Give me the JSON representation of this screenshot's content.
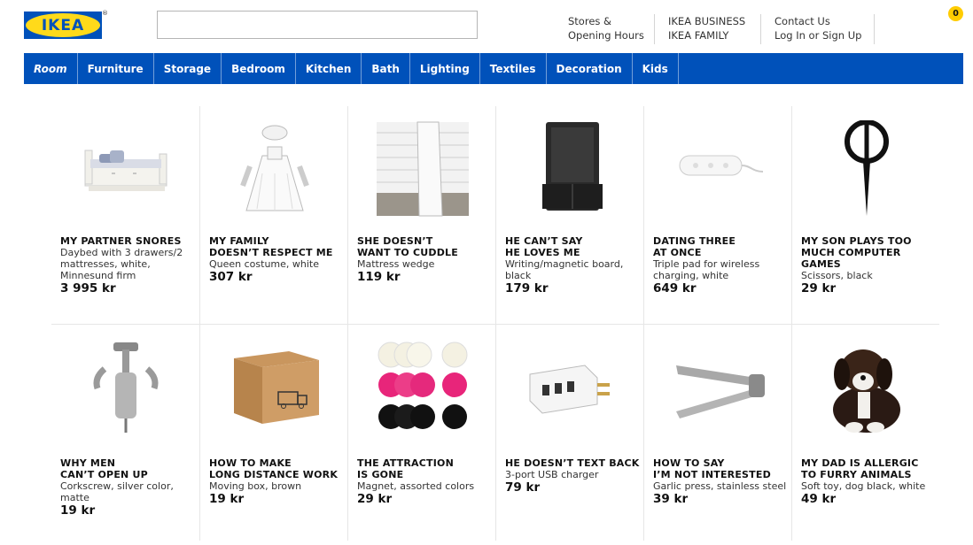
{
  "header": {
    "logo_text": "IKEA",
    "logo_reg": "®",
    "search": {
      "value": "",
      "placeholder": ""
    },
    "links": {
      "stores_line1": "Stores &",
      "stores_line2": "Opening Hours",
      "business": "IKEA BUSINESS",
      "family": "IKEA FAMILY",
      "contact": "Contact Us",
      "login": "Log In or Sign Up"
    },
    "cart_count": "0"
  },
  "nav": {
    "items": [
      "Room",
      "Furniture",
      "Storage",
      "Bedroom",
      "Kitchen",
      "Bath",
      "Lighting",
      "Textiles",
      "Decoration",
      "Kids"
    ]
  },
  "colors": {
    "brand_blue": "#0051ba",
    "brand_yellow": "#ffda1a",
    "badge": "#ffcc00"
  },
  "products": [
    {
      "title": "MY PARTNER SNORES",
      "desc": "Daybed with 3 drawers/2 mattresses, white, Minnesund firm",
      "price": "3 995 kr",
      "icon": "daybed-icon"
    },
    {
      "title": "MY FAMILY\nDOESN’T RESPECT ME",
      "desc": "Queen costume, white",
      "price": "307 kr",
      "icon": "queen-costume-icon"
    },
    {
      "title": "SHE DOESN’T\nWANT TO CUDDLE",
      "desc": "Mattress wedge",
      "price": "119 kr",
      "icon": "mattress-wedge-icon"
    },
    {
      "title": "HE CAN’T SAY\nHE LOVES ME",
      "desc": "Writing/magnetic board, black",
      "price": "179 kr",
      "icon": "magnetic-board-icon"
    },
    {
      "title": "DATING THREE\nAT ONCE",
      "desc": "Triple pad for wireless charging, white",
      "price": "649 kr",
      "icon": "charging-pad-icon"
    },
    {
      "title": "MY SON PLAYS TOO MUCH COMPUTER GAMES",
      "desc": "Scissors, black",
      "price": "29 kr",
      "icon": "scissors-icon"
    },
    {
      "title": "WHY MEN\nCAN’T OPEN UP",
      "desc": "Corkscrew, silver color, matte",
      "price": "19 kr",
      "icon": "corkscrew-icon"
    },
    {
      "title": "HOW TO MAKE\nLONG DISTANCE WORK",
      "desc": "Moving box, brown",
      "price": "19 kr",
      "icon": "moving-box-icon"
    },
    {
      "title": "THE ATTRACTION\nIS GONE",
      "desc": "Magnet, assorted colors",
      "price": "29 kr",
      "icon": "magnets-icon"
    },
    {
      "title": "HE DOESN’T TEXT BACK",
      "desc": "3-port USB charger",
      "price": "79 kr",
      "icon": "usb-charger-icon"
    },
    {
      "title": "HOW TO SAY\nI’M NOT INTERESTED",
      "desc": "Garlic press, stainless steel",
      "price": "39 kr",
      "icon": "garlic-press-icon"
    },
    {
      "title": "MY DAD IS ALLERGIC\nTO FURRY ANIMALS",
      "desc": "Soft toy, dog black, white",
      "price": "49 kr",
      "icon": "soft-toy-dog-icon"
    }
  ]
}
